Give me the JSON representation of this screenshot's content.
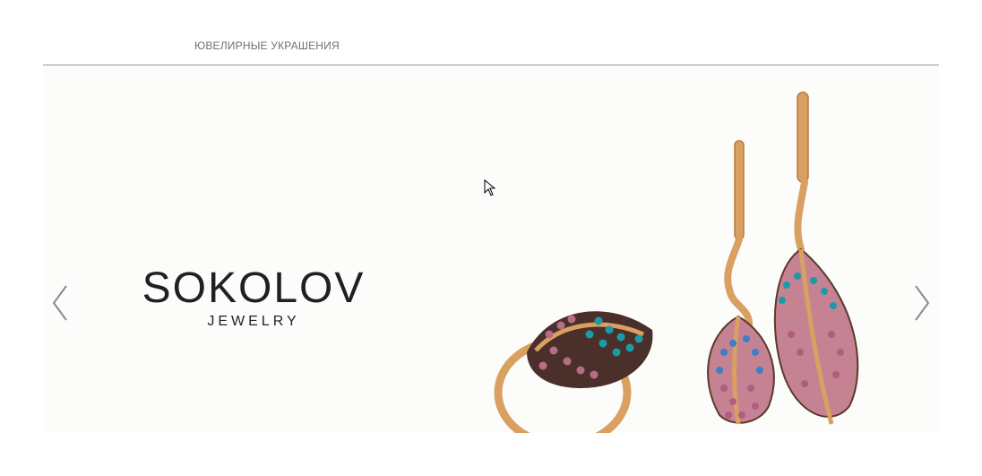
{
  "nav": {
    "menu_label": "ЮВЕЛИРНЫЕ УКРАШЕНИЯ"
  },
  "slider": {
    "brand_name": "SOKOLOV",
    "brand_sub": "JEWELRY",
    "prev_icon": "chevron-left-icon",
    "next_icon": "chevron-right-icon"
  },
  "colors": {
    "gold": "#d9a062",
    "turquoise": "#1b9aa8",
    "rose": "#b76d86",
    "text_dark": "#231f20",
    "nav_text": "#6f6f6f"
  }
}
